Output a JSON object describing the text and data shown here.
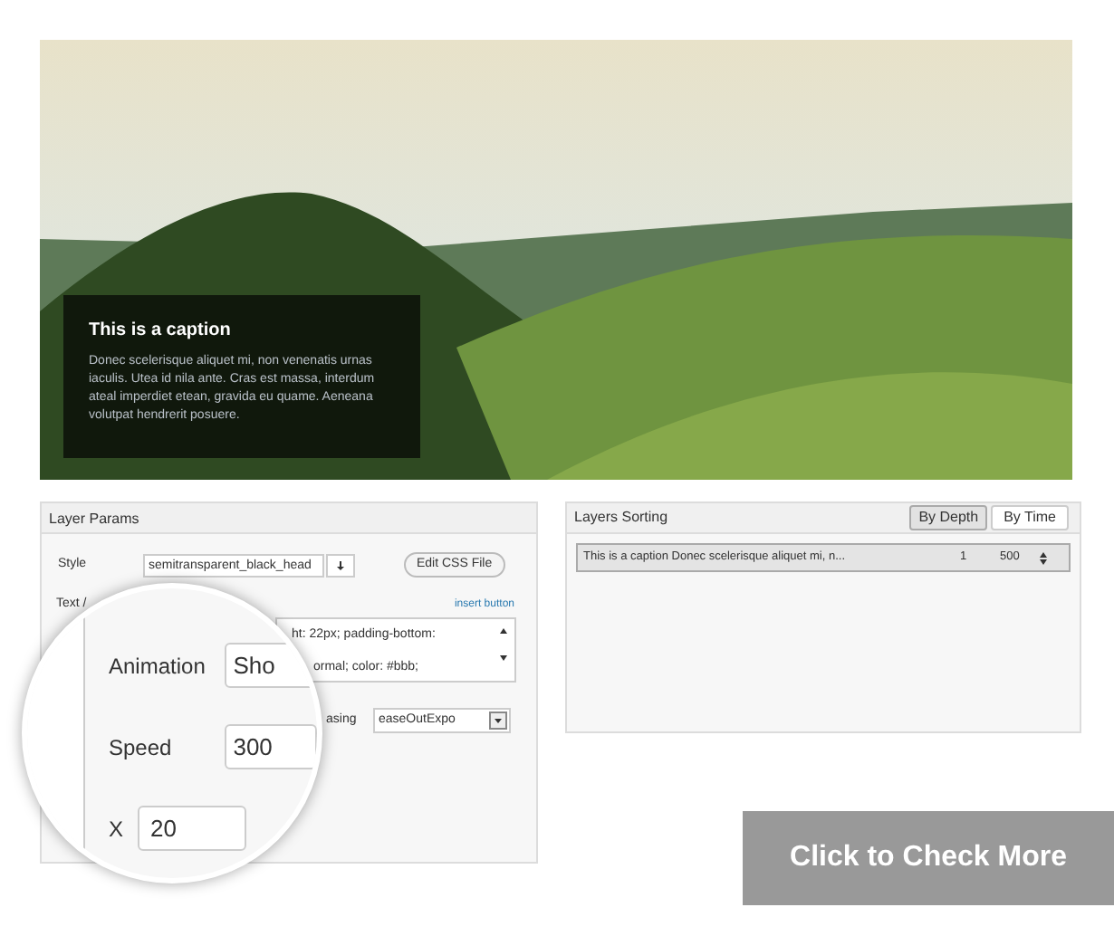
{
  "slide": {
    "caption": {
      "title": "This is a caption",
      "text": "Donec scelerisque aliquet mi, non venenatis urnas iaculis. Utea id nila ante. Cras est massa, interdum ateal imperdiet etean, gravida eu quame. Aeneana volutpat hendrerit posuere."
    }
  },
  "layer_params": {
    "title": "Layer Params",
    "style": {
      "label": "Style",
      "value": "semitransparent_black_head",
      "button": "Edit CSS File"
    },
    "text_label": "Text /",
    "insert_button": "insert button",
    "text_lines": [
      "ht: 22px; padding-bottom:",
      "ormal; color: #bbb;"
    ],
    "easing": {
      "label": "asing",
      "value": "easeOutExpo"
    }
  },
  "magnifier": {
    "fields": [
      {
        "label": "Animation",
        "value": "Sho"
      },
      {
        "label": "Speed",
        "value": "300"
      },
      {
        "label": "X",
        "value": "20"
      }
    ]
  },
  "layers_sorting": {
    "title": "Layers Sorting",
    "tabs": [
      {
        "label": "By Depth",
        "selected": true
      },
      {
        "label": "By Time",
        "selected": false
      }
    ],
    "rows": [
      {
        "name": "This is a caption Donec scelerisque aliquet mi, n...",
        "depth": "1",
        "time": "500"
      }
    ]
  },
  "cta_button": "Click to Check More"
}
